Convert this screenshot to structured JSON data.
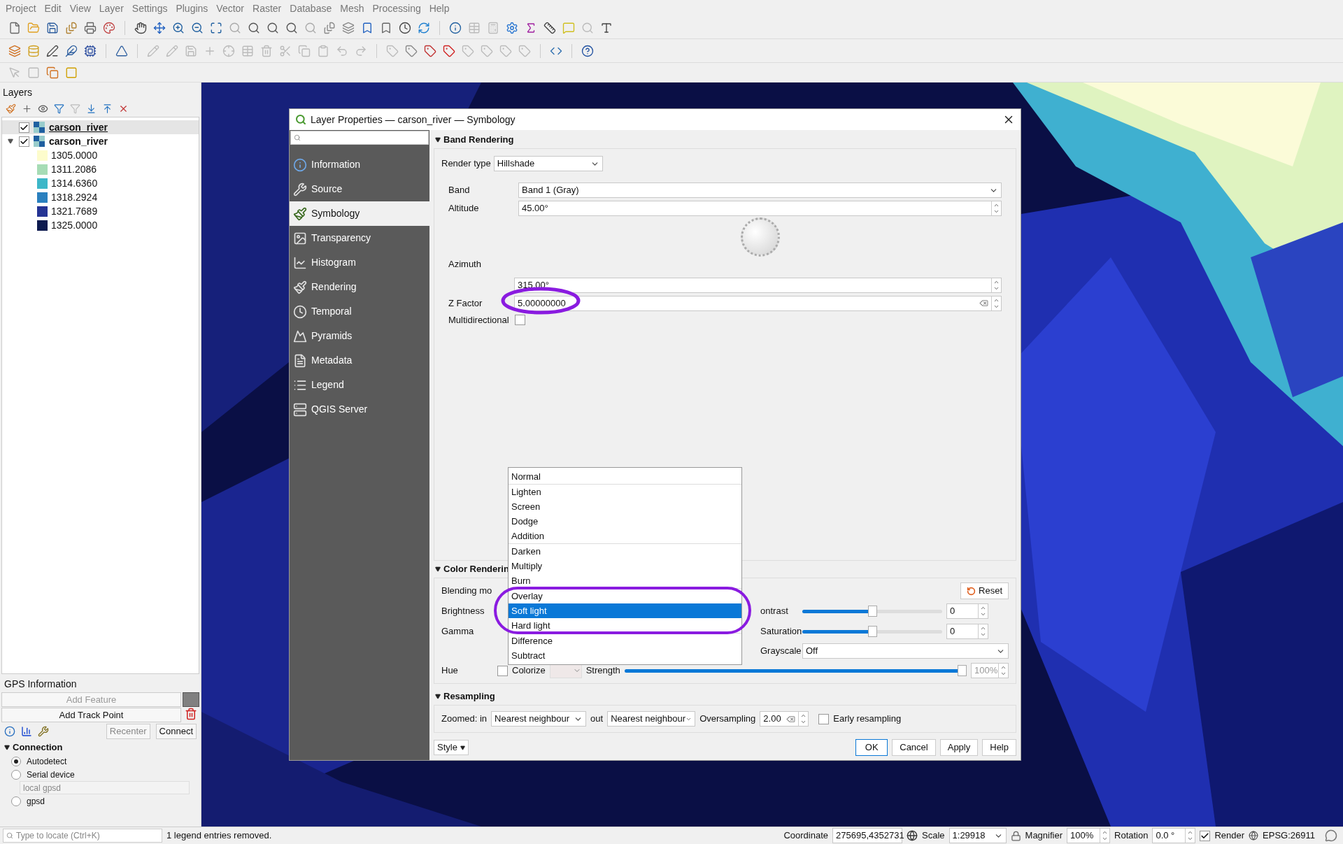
{
  "menu": [
    "Project",
    "Edit",
    "View",
    "Layer",
    "Settings",
    "Plugins",
    "Vector",
    "Raster",
    "Database",
    "Mesh",
    "Processing",
    "Help"
  ],
  "layers_panel": {
    "title": "Layers",
    "layers": [
      {
        "name": "carson_river",
        "checked": true,
        "selected": true
      },
      {
        "name": "carson_river",
        "checked": true,
        "selected": false,
        "expanded": true,
        "children": [
          {
            "label": "1305.0000",
            "color": "#fdfccc"
          },
          {
            "label": "1311.2086",
            "color": "#a6dcb5"
          },
          {
            "label": "1314.6360",
            "color": "#3db7c8"
          },
          {
            "label": "1318.2924",
            "color": "#2a80bf"
          },
          {
            "label": "1321.7689",
            "color": "#253494"
          },
          {
            "label": "1325.0000",
            "color": "#0d1a4f"
          }
        ]
      }
    ]
  },
  "gps_panel": {
    "title": "GPS Information",
    "buttons": [
      {
        "label": "Add Feature",
        "disabled": true
      },
      {
        "label": "Add Track Point",
        "disabled": false
      }
    ],
    "action_buttons": [
      {
        "label": "Recenter",
        "disabled": true
      },
      {
        "label": "Connect",
        "disabled": false
      }
    ],
    "section": {
      "title": "Connection",
      "expanded": true,
      "options": [
        {
          "label": "Autodetect",
          "selected": true
        },
        {
          "label": "Serial device",
          "selected": false
        },
        {
          "label": "gpsd",
          "selected": false
        }
      ],
      "device_field": "local gpsd"
    }
  },
  "locator": {
    "placeholder": "Type to locate (Ctrl+K)"
  },
  "message": "1 legend entries removed.",
  "status_bar": {
    "coordinate_label": "Coordinate",
    "coordinate": "275695,4352731",
    "scale_label": "Scale",
    "scale": "1:29918",
    "magnifier_label": "Magnifier",
    "magnifier": "100%",
    "rotation_label": "Rotation",
    "rotation": "0.0 °",
    "render_label": "Render",
    "render_checked": true,
    "crs": "EPSG:26911"
  },
  "dialog": {
    "title": "Layer Properties — carson_river — Symbology",
    "nav": [
      {
        "label": "Information",
        "selected": false
      },
      {
        "label": "Source",
        "selected": false
      },
      {
        "label": "Symbology",
        "selected": true
      },
      {
        "label": "Transparency",
        "selected": false
      },
      {
        "label": "Histogram",
        "selected": false
      },
      {
        "label": "Rendering",
        "selected": false
      },
      {
        "label": "Temporal",
        "selected": false
      },
      {
        "label": "Pyramids",
        "selected": false
      },
      {
        "label": "Metadata",
        "selected": false
      },
      {
        "label": "Legend",
        "selected": false
      },
      {
        "label": "QGIS Server",
        "selected": false
      }
    ],
    "band_rendering": {
      "title": "Band Rendering",
      "render_type_label": "Render type",
      "render_type": "Hillshade",
      "band_label": "Band",
      "band": "Band 1 (Gray)",
      "altitude_label": "Altitude",
      "altitude": "45.00°",
      "azimuth_label": "Azimuth",
      "azimuth": "315.00°",
      "z_factor_label": "Z Factor",
      "z_factor": "5.00000000",
      "multidirectional_label": "Multidirectional",
      "multidirectional": false
    },
    "color_rendering": {
      "title": "Color Renderin",
      "blending_label": "Blending mo",
      "brightness_label": "Brightness",
      "gamma_label": "Gamma",
      "reset": "Reset",
      "contrast_label": "ontrast",
      "contrast": {
        "level": 0.5,
        "value": "0"
      },
      "saturation_label": "Saturation",
      "saturation": {
        "level": 0.5,
        "value": "0"
      },
      "grayscale_label": "Grayscale",
      "grayscale": "Off",
      "hue_label": "Hue",
      "colorize_label": "Colorize",
      "colorize": false,
      "strength_label": "Strength",
      "strength": {
        "level": 1.0,
        "value": "100%",
        "disabled": true
      }
    },
    "resampling": {
      "title": "Resampling",
      "zoomed_in_label": "Zoomed: in",
      "zoomed_in": "Nearest neighbour",
      "out_label": "out",
      "zoomed_out": "Nearest neighbour",
      "oversampling_label": "Oversampling",
      "oversampling": "2.00",
      "early_label": "Early resampling",
      "early": false
    },
    "buttons": {
      "style": "Style",
      "actions": [
        "OK",
        "Cancel",
        "Apply",
        "Help"
      ]
    },
    "blend_menu": [
      [
        {
          "label": "Normal",
          "selected": false
        }
      ],
      [
        {
          "label": "Lighten",
          "selected": false
        },
        {
          "label": "Screen",
          "selected": false
        },
        {
          "label": "Dodge",
          "selected": false
        },
        {
          "label": "Addition",
          "selected": false
        }
      ],
      [
        {
          "label": "Darken",
          "selected": false
        },
        {
          "label": "Multiply",
          "selected": false
        },
        {
          "label": "Burn",
          "selected": false
        }
      ],
      [
        {
          "label": "Overlay",
          "selected": false
        },
        {
          "label": "Soft light",
          "selected": true
        },
        {
          "label": "Hard light",
          "selected": false
        }
      ],
      [
        {
          "label": "Difference",
          "selected": false
        },
        {
          "label": "Subtract",
          "selected": false
        }
      ]
    ]
  }
}
